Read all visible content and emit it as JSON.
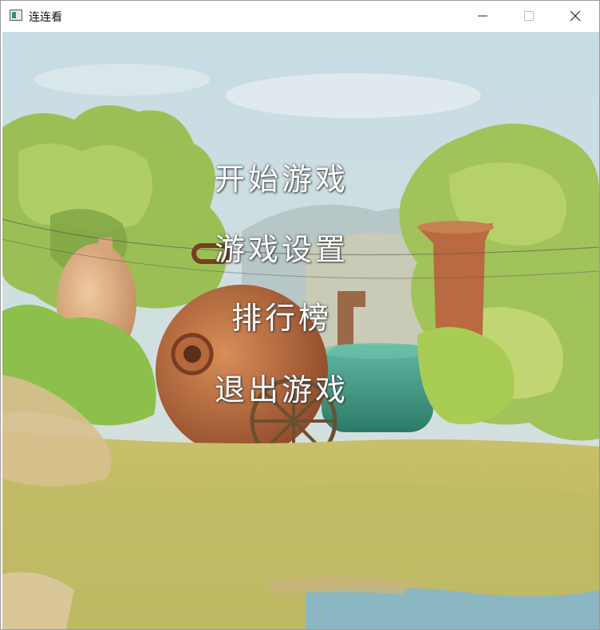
{
  "window": {
    "title": "连连看"
  },
  "controls": {
    "minimize_icon": "minimize-icon",
    "maximize_icon": "maximize-icon",
    "close_icon": "close-icon"
  },
  "menu": {
    "start": "开始游戏",
    "settings": "游戏设置",
    "leaderboard": "排行榜",
    "exit": "退出游戏"
  },
  "colors": {
    "sky": "#b9d3de",
    "grass": "#c9c26a",
    "tree": "#8fb64a",
    "copper": "#b86a3e",
    "tank": "#3f9b86"
  }
}
